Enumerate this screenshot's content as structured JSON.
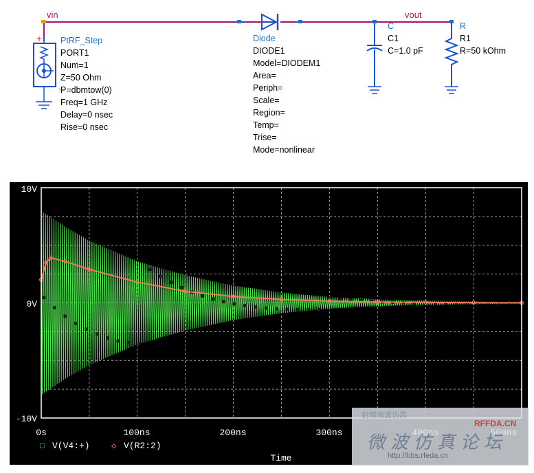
{
  "schematic": {
    "nets": {
      "vin": "vin",
      "vout": "vout"
    },
    "port": {
      "type": "PtRF_Step",
      "lines": [
        "PORT1",
        "Num=1",
        "Z=50 Ohm",
        "P=dbmtow(0)",
        "Freq=1 GHz",
        "Delay=0 nsec",
        "Rise=0 nsec"
      ],
      "pin_plus": "+",
      "pin_minus": "-",
      "symbol_num": "1"
    },
    "diode": {
      "type": "Diode",
      "lines": [
        "DIODE1",
        "Model=DIODEM1",
        "Area=",
        "Periph=",
        "Scale=",
        "Region=",
        "Temp=",
        "Trise=",
        "Mode=nonlinear"
      ]
    },
    "capacitor": {
      "type": "C",
      "lines": [
        "C1",
        "C=1.0 pF"
      ]
    },
    "resistor": {
      "type": "R",
      "lines": [
        "R1",
        "R=50 kOhm"
      ]
    }
  },
  "plot": {
    "y_ticks": [
      "10V",
      "0V",
      "-10V"
    ],
    "x_ticks": [
      "0s",
      "100ns",
      "200ns",
      "300ns",
      "400ns",
      "500ns"
    ],
    "x_axis_title": "Time",
    "legend": [
      {
        "marker": "□",
        "label": "V(V4:+)",
        "color": "#4fe04f"
      },
      {
        "marker": "◇",
        "label": "V(R2:2)",
        "color": "#f07a5a"
      }
    ]
  },
  "chart_data": {
    "type": "line",
    "xlabel": "Time",
    "x_unit": "ns",
    "y_unit": "V",
    "xlim": [
      0,
      500
    ],
    "ylim": [
      -10,
      10
    ],
    "grid": true,
    "legend_placement": "bottom-left",
    "series": [
      {
        "name": "V(V4:+)",
        "color": "#4fe04f",
        "description_kind": "decaying oscillation envelope",
        "envelope_x": [
          0,
          25,
          50,
          100,
          150,
          200,
          250,
          300,
          350,
          400,
          450,
          500
        ],
        "envelope_y": [
          8.0,
          6.6,
          5.4,
          3.6,
          2.4,
          1.5,
          0.9,
          0.5,
          0.3,
          0.15,
          0.08,
          0.04
        ]
      },
      {
        "name": "V(R2:2)",
        "color": "#f07a5a",
        "x": [
          0,
          5,
          10,
          25,
          50,
          100,
          150,
          200,
          250,
          300,
          350,
          400,
          450,
          500
        ],
        "y": [
          2.0,
          3.5,
          3.9,
          3.6,
          2.9,
          1.8,
          1.0,
          0.55,
          0.3,
          0.15,
          0.08,
          0.04,
          0.02,
          0.0
        ]
      }
    ]
  },
  "watermark": {
    "top": "射频微波仿真",
    "brand": "RFFDA.CN",
    "chinese": "微波仿真论坛",
    "url": "http://bbs.rfeda.cn"
  }
}
